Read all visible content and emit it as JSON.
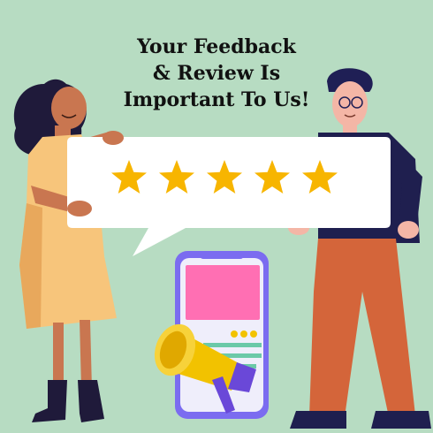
{
  "headline": {
    "line1": "Your Feedback",
    "line2": "& Review Is",
    "line3": "Important To Us!"
  },
  "rating": {
    "stars": 5,
    "max": 5
  },
  "colors": {
    "background": "#b7dcc2",
    "star": "#f7b500",
    "bubble": "#ffffff",
    "phone_frame": "#7b6cf0",
    "phone_screen": "#ff6fb3",
    "megaphone": "#f2c200"
  },
  "icons": [
    "star-icon",
    "megaphone-icon",
    "phone-illustration",
    "speech-bubble"
  ]
}
